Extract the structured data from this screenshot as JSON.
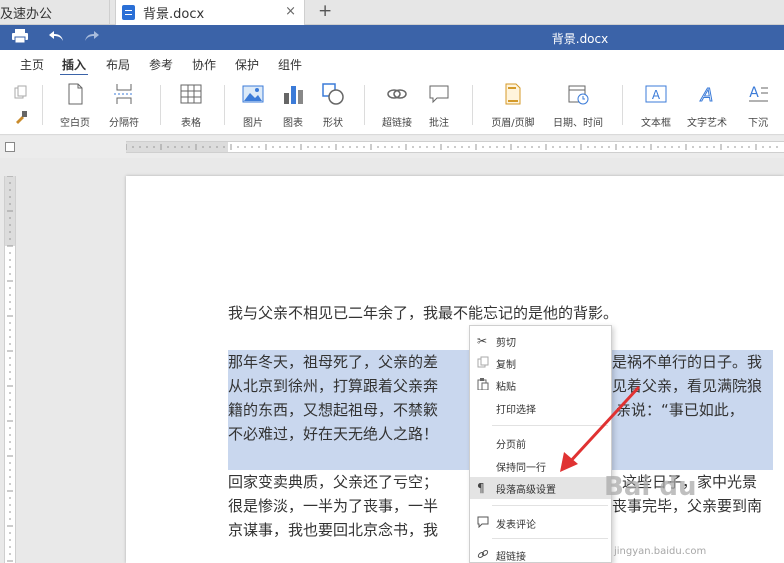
{
  "tabs": {
    "other": "及速办公",
    "active": "背景.docx",
    "close": "×",
    "add": "+"
  },
  "titlebar": {
    "title": "背景.docx"
  },
  "menu": [
    "主页",
    "插入",
    "布局",
    "参考",
    "协作",
    "保护",
    "组件"
  ],
  "menu_active_index": 1,
  "ribbon": [
    {
      "label": "空白页",
      "icon": "blank-page-icon"
    },
    {
      "label": "分隔符",
      "icon": "separator-icon"
    },
    {
      "label": "表格",
      "icon": "table-icon"
    },
    {
      "label": "图片",
      "icon": "image-icon"
    },
    {
      "label": "图表",
      "icon": "chart-icon"
    },
    {
      "label": "形状",
      "icon": "shape-icon"
    },
    {
      "label": "超链接",
      "icon": "hyperlink-icon"
    },
    {
      "label": "批注",
      "icon": "comment-icon"
    },
    {
      "label": "页眉/页脚",
      "icon": "header-footer-icon"
    },
    {
      "label": "日期、时间",
      "icon": "date-time-icon"
    },
    {
      "label": "文本框",
      "icon": "text-box-icon"
    },
    {
      "label": "文字艺术",
      "icon": "word-art-icon"
    },
    {
      "label": "下沉",
      "icon": "drop-cap-icon"
    }
  ],
  "document": {
    "p1": "我与父亲不相见已二年余了，我最不能忘记的是他的背影。",
    "p2_l1": "那年冬天，祖母死了，父亲的差",
    "p2_l1b": "是祸不单行的日子。我",
    "p2_l2": "从北京到徐州，打算跟着父亲奔",
    "p2_l2b": "见着父亲，看见满院狼",
    "p2_l3": "籍的东西，又想起祖母，不禁簌",
    "p2_l3b": "亲说：“事已如此，",
    "p2_l4": "不必难过，好在天无绝人之路！",
    "p3_l1": "回家变卖典质，父亲还了亏空；",
    "p3_l1b": "这些日子，家中光景",
    "p3_l2": "很是惨淡，一半为了丧事，一半",
    "p3_l2b": "丧事完毕，父亲要到南",
    "p3_l3": "京谋事，我也要回北京念书，我"
  },
  "context_menu": [
    {
      "label": "剪切",
      "icon": "scissors-icon"
    },
    {
      "label": "复制",
      "icon": "copy-icon"
    },
    {
      "label": "粘贴",
      "icon": "paste-icon"
    },
    {
      "label": "打印选择",
      "icon": ""
    },
    {
      "label": "分页前",
      "icon": ""
    },
    {
      "label": "保持同一行",
      "icon": ""
    },
    {
      "label": "段落高级设置",
      "icon": "paragraph-icon"
    },
    {
      "label": "发表评论",
      "icon": "comment-icon"
    },
    {
      "label": "超链接",
      "icon": "hyperlink-icon"
    }
  ],
  "watermark": {
    "logo": "Bai du",
    "url": "jingyan.baidu.com"
  },
  "colors": {
    "titlebar": "#3b63a8",
    "selection": "#c9d7ee",
    "arrow": "#e03232"
  }
}
